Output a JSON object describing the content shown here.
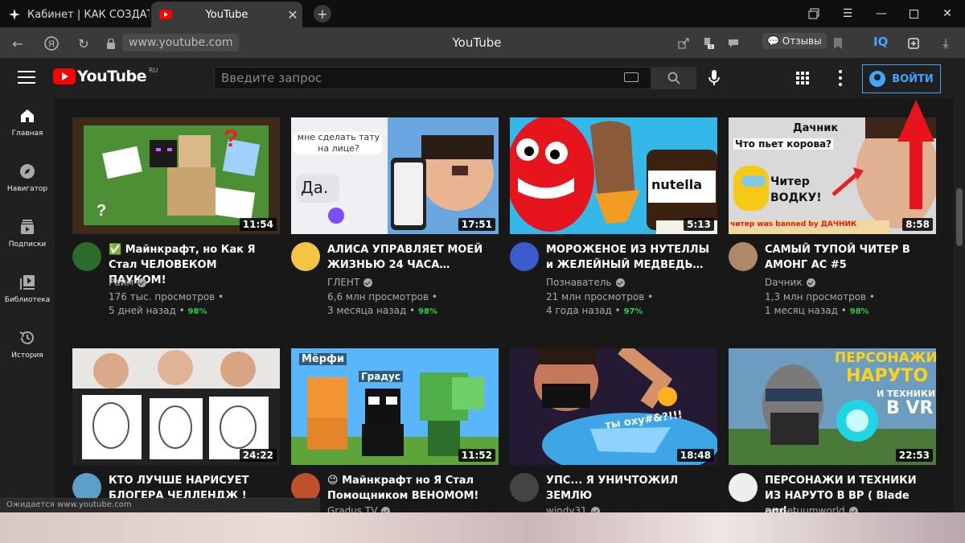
{
  "browser": {
    "tabs": [
      {
        "title": "Кабинет | КАК СОЗДАТЬ И",
        "icon": "sparkle-icon"
      },
      {
        "title": "YouTube",
        "icon": "youtube-icon"
      }
    ],
    "url": "www.youtube.com",
    "page_title": "YouTube",
    "reviews_label": "Отзывы",
    "iq_label": "IQ",
    "status_text": "Ожидается www.youtube.com"
  },
  "header": {
    "logo_text": "YouTube",
    "region": "RU",
    "search_placeholder": "Введите запрос",
    "signin_label": "ВОЙТИ"
  },
  "sidebar": {
    "items": [
      {
        "label": "Главная",
        "icon": "home-icon"
      },
      {
        "label": "Навигатор",
        "icon": "compass-icon"
      },
      {
        "label": "Подписки",
        "icon": "subscriptions-icon"
      },
      {
        "label": "Библиотека",
        "icon": "library-icon"
      },
      {
        "label": "История",
        "icon": "history-icon"
      }
    ]
  },
  "videos": [
    {
      "title": "✅ Майнкрафт, но Как Я Стал ЧЕЛОВЕКОМ ПАУКОМ!",
      "channel": "Райм",
      "views": "176 тыс. просмотров",
      "ago": "5 дней назад",
      "rating": "98%",
      "duration": "11:54"
    },
    {
      "title": "АЛИСА УПРАВЛЯЕТ МОЕЙ ЖИЗНЬЮ 24 ЧАСА…",
      "channel": "ГЛЕНТ",
      "views": "6,6 млн просмотров",
      "ago": "3 месяца назад",
      "rating": "98%",
      "duration": "17:51"
    },
    {
      "title": "МОРОЖЕНОЕ ИЗ НУТЕЛЛЫ и ЖЕЛЕЙНЫЙ МЕДВЕДЬ…",
      "channel": "Познаватель",
      "views": "21 млн просмотров",
      "ago": "4 года назад",
      "rating": "97%",
      "duration": "5:13"
    },
    {
      "title": "САМЫЙ ТУПОЙ ЧИТЕР В АМОНГ АС #5",
      "channel": "Dачник",
      "views": "1,3 млн просмотров",
      "ago": "1 месяц назад",
      "rating": "98%",
      "duration": "8:58"
    },
    {
      "title": "КТО ЛУЧШЕ НАРИСУЕТ БЛОГЕРА ЧЕЛЛЕНДЖ !",
      "channel": "",
      "views": "",
      "ago": "",
      "rating": "",
      "duration": "24:22"
    },
    {
      "title": "😉 Майнкрафт но Я Стал Помощником ВЕНОМОМ!",
      "channel": "Gradus TV",
      "views": "",
      "ago": "",
      "rating": "",
      "duration": "11:52"
    },
    {
      "title": "УПС... Я УНИЧТОЖИЛ ЗЕМЛЮ",
      "channel": "windy31",
      "views": "",
      "ago": "",
      "rating": "",
      "duration": "18:48"
    },
    {
      "title": "ПЕРСОНАЖИ И ТЕХНИКИ ИЗ НАРУТО В ВР ( Blade and…",
      "channel": "perpetuumworld",
      "views": "",
      "ago": "",
      "rating": "",
      "duration": "22:53"
    }
  ],
  "thumb_text": {
    "t2_q": "мне сделать тату на лице?",
    "t2_a": "Да.",
    "t3_brand": "nutella",
    "t4_a": "Дачник",
    "t4_b": "Что пьет корова?",
    "t4_c": "Читер",
    "t4_d": "ВОДКУ!",
    "t4_e": "читер was banned by ДАЧНИК",
    "t6_a": "Мёрфи",
    "t6_b": "Градус",
    "t7_a": "ты оху#&?!!!",
    "t8_a": "ПЕРСОНАЖИ",
    "t8_b": "НАРУТО",
    "t8_c": "И ТЕХНИКИ",
    "t8_d": "В VR"
  },
  "colors": {
    "accent": "#3ea6ff",
    "brand": "#ff0000",
    "rating": "#2ecc40"
  }
}
